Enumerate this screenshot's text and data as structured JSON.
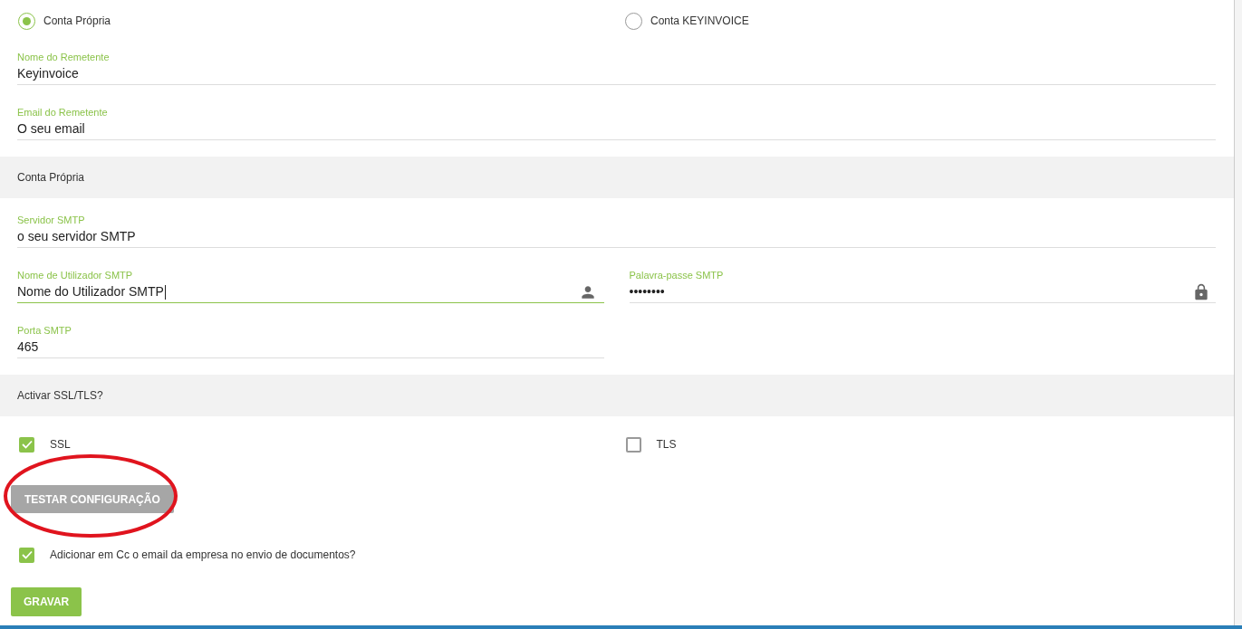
{
  "account_type": [
    {
      "label": "Conta Própria",
      "selected": true
    },
    {
      "label": "Conta KEYINVOICE",
      "selected": false
    }
  ],
  "sender_fields": [
    {
      "label": "Nome do Remetente",
      "value": "Keyinvoice"
    },
    {
      "label": "Email do Remetente",
      "value": "O seu email"
    }
  ],
  "own_account": {
    "title": "Conta Própria",
    "server": {
      "label": "Servidor SMTP",
      "value": "o seu servidor SMTP",
      "focused": false
    },
    "username": {
      "label": "Nome de Utilizador SMTP",
      "value": "Nome do Utilizador SMTP",
      "focused": true
    },
    "password": {
      "label": "Palavra-passe SMTP",
      "value": "••••••••",
      "focused": false
    },
    "port": {
      "label": "Porta SMTP",
      "value": "465",
      "focused": false
    }
  },
  "ssl_tls": {
    "title": "Activar SSL/TLS?",
    "options": [
      {
        "label": "SSL",
        "checked": true
      },
      {
        "label": "TLS",
        "checked": false
      }
    ]
  },
  "test_button": "TESTAR CONFIGURAÇÃO",
  "cc_option": {
    "label": "Adicionar em Cc o email da empresa no envio de documentos?",
    "checked": true
  },
  "save_button": "GRAVAR"
}
